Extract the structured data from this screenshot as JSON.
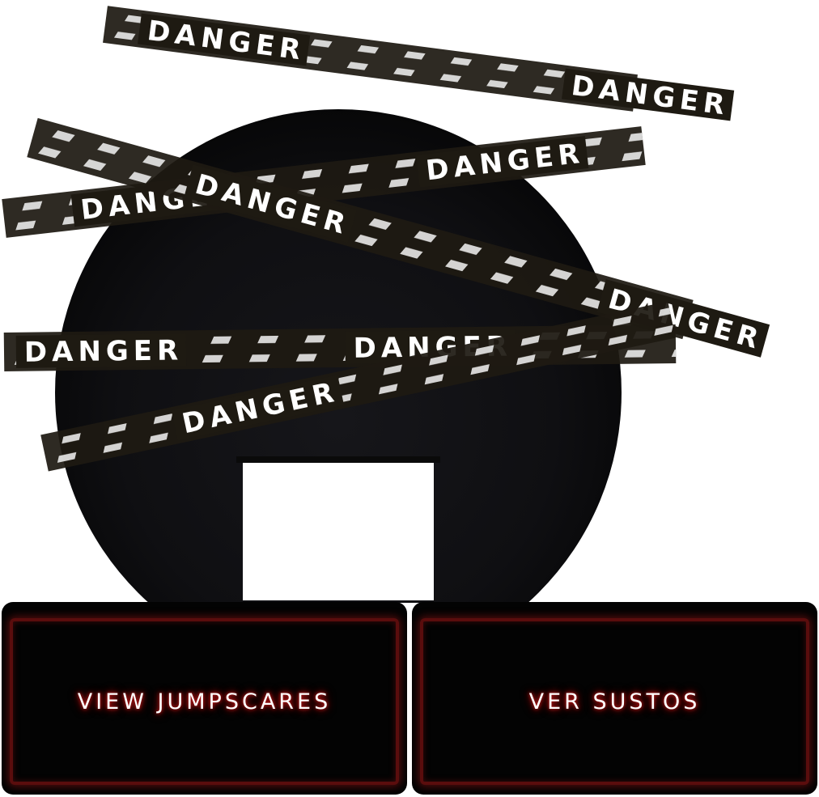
{
  "scene": {
    "tape_word": "DANGER",
    "colors": {
      "background": "#ffffff",
      "circle": "#121215",
      "tape": "#1e1a12",
      "tape_text": "#ffffff",
      "doorway": "#ffffff"
    }
  },
  "menu": {
    "view_jumpscares_label": "VIEW JUMPSCARES",
    "ver_sustos_label": "VER SUSTOS",
    "colors": {
      "button_bg": "#030303",
      "button_border": "#5a0d0d",
      "label_glow": "#c81818"
    }
  }
}
